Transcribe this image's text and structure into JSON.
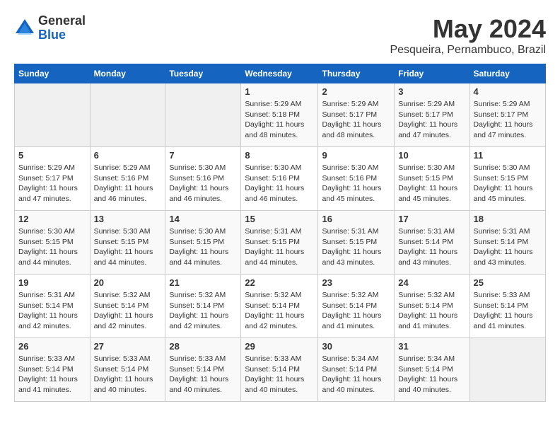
{
  "logo": {
    "general": "General",
    "blue": "Blue"
  },
  "title": "May 2024",
  "location": "Pesqueira, Pernambuco, Brazil",
  "days_of_week": [
    "Sunday",
    "Monday",
    "Tuesday",
    "Wednesday",
    "Thursday",
    "Friday",
    "Saturday"
  ],
  "weeks": [
    [
      {
        "day": "",
        "info": ""
      },
      {
        "day": "",
        "info": ""
      },
      {
        "day": "",
        "info": ""
      },
      {
        "day": "1",
        "sunrise": "Sunrise: 5:29 AM",
        "sunset": "Sunset: 5:18 PM",
        "daylight": "Daylight: 11 hours and 48 minutes."
      },
      {
        "day": "2",
        "sunrise": "Sunrise: 5:29 AM",
        "sunset": "Sunset: 5:17 PM",
        "daylight": "Daylight: 11 hours and 48 minutes."
      },
      {
        "day": "3",
        "sunrise": "Sunrise: 5:29 AM",
        "sunset": "Sunset: 5:17 PM",
        "daylight": "Daylight: 11 hours and 47 minutes."
      },
      {
        "day": "4",
        "sunrise": "Sunrise: 5:29 AM",
        "sunset": "Sunset: 5:17 PM",
        "daylight": "Daylight: 11 hours and 47 minutes."
      }
    ],
    [
      {
        "day": "5",
        "sunrise": "Sunrise: 5:29 AM",
        "sunset": "Sunset: 5:17 PM",
        "daylight": "Daylight: 11 hours and 47 minutes."
      },
      {
        "day": "6",
        "sunrise": "Sunrise: 5:29 AM",
        "sunset": "Sunset: 5:16 PM",
        "daylight": "Daylight: 11 hours and 46 minutes."
      },
      {
        "day": "7",
        "sunrise": "Sunrise: 5:30 AM",
        "sunset": "Sunset: 5:16 PM",
        "daylight": "Daylight: 11 hours and 46 minutes."
      },
      {
        "day": "8",
        "sunrise": "Sunrise: 5:30 AM",
        "sunset": "Sunset: 5:16 PM",
        "daylight": "Daylight: 11 hours and 46 minutes."
      },
      {
        "day": "9",
        "sunrise": "Sunrise: 5:30 AM",
        "sunset": "Sunset: 5:16 PM",
        "daylight": "Daylight: 11 hours and 45 minutes."
      },
      {
        "day": "10",
        "sunrise": "Sunrise: 5:30 AM",
        "sunset": "Sunset: 5:15 PM",
        "daylight": "Daylight: 11 hours and 45 minutes."
      },
      {
        "day": "11",
        "sunrise": "Sunrise: 5:30 AM",
        "sunset": "Sunset: 5:15 PM",
        "daylight": "Daylight: 11 hours and 45 minutes."
      }
    ],
    [
      {
        "day": "12",
        "sunrise": "Sunrise: 5:30 AM",
        "sunset": "Sunset: 5:15 PM",
        "daylight": "Daylight: 11 hours and 44 minutes."
      },
      {
        "day": "13",
        "sunrise": "Sunrise: 5:30 AM",
        "sunset": "Sunset: 5:15 PM",
        "daylight": "Daylight: 11 hours and 44 minutes."
      },
      {
        "day": "14",
        "sunrise": "Sunrise: 5:30 AM",
        "sunset": "Sunset: 5:15 PM",
        "daylight": "Daylight: 11 hours and 44 minutes."
      },
      {
        "day": "15",
        "sunrise": "Sunrise: 5:31 AM",
        "sunset": "Sunset: 5:15 PM",
        "daylight": "Daylight: 11 hours and 44 minutes."
      },
      {
        "day": "16",
        "sunrise": "Sunrise: 5:31 AM",
        "sunset": "Sunset: 5:15 PM",
        "daylight": "Daylight: 11 hours and 43 minutes."
      },
      {
        "day": "17",
        "sunrise": "Sunrise: 5:31 AM",
        "sunset": "Sunset: 5:14 PM",
        "daylight": "Daylight: 11 hours and 43 minutes."
      },
      {
        "day": "18",
        "sunrise": "Sunrise: 5:31 AM",
        "sunset": "Sunset: 5:14 PM",
        "daylight": "Daylight: 11 hours and 43 minutes."
      }
    ],
    [
      {
        "day": "19",
        "sunrise": "Sunrise: 5:31 AM",
        "sunset": "Sunset: 5:14 PM",
        "daylight": "Daylight: 11 hours and 42 minutes."
      },
      {
        "day": "20",
        "sunrise": "Sunrise: 5:32 AM",
        "sunset": "Sunset: 5:14 PM",
        "daylight": "Daylight: 11 hours and 42 minutes."
      },
      {
        "day": "21",
        "sunrise": "Sunrise: 5:32 AM",
        "sunset": "Sunset: 5:14 PM",
        "daylight": "Daylight: 11 hours and 42 minutes."
      },
      {
        "day": "22",
        "sunrise": "Sunrise: 5:32 AM",
        "sunset": "Sunset: 5:14 PM",
        "daylight": "Daylight: 11 hours and 42 minutes."
      },
      {
        "day": "23",
        "sunrise": "Sunrise: 5:32 AM",
        "sunset": "Sunset: 5:14 PM",
        "daylight": "Daylight: 11 hours and 41 minutes."
      },
      {
        "day": "24",
        "sunrise": "Sunrise: 5:32 AM",
        "sunset": "Sunset: 5:14 PM",
        "daylight": "Daylight: 11 hours and 41 minutes."
      },
      {
        "day": "25",
        "sunrise": "Sunrise: 5:33 AM",
        "sunset": "Sunset: 5:14 PM",
        "daylight": "Daylight: 11 hours and 41 minutes."
      }
    ],
    [
      {
        "day": "26",
        "sunrise": "Sunrise: 5:33 AM",
        "sunset": "Sunset: 5:14 PM",
        "daylight": "Daylight: 11 hours and 41 minutes."
      },
      {
        "day": "27",
        "sunrise": "Sunrise: 5:33 AM",
        "sunset": "Sunset: 5:14 PM",
        "daylight": "Daylight: 11 hours and 40 minutes."
      },
      {
        "day": "28",
        "sunrise": "Sunrise: 5:33 AM",
        "sunset": "Sunset: 5:14 PM",
        "daylight": "Daylight: 11 hours and 40 minutes."
      },
      {
        "day": "29",
        "sunrise": "Sunrise: 5:33 AM",
        "sunset": "Sunset: 5:14 PM",
        "daylight": "Daylight: 11 hours and 40 minutes."
      },
      {
        "day": "30",
        "sunrise": "Sunrise: 5:34 AM",
        "sunset": "Sunset: 5:14 PM",
        "daylight": "Daylight: 11 hours and 40 minutes."
      },
      {
        "day": "31",
        "sunrise": "Sunrise: 5:34 AM",
        "sunset": "Sunset: 5:14 PM",
        "daylight": "Daylight: 11 hours and 40 minutes."
      },
      {
        "day": "",
        "info": ""
      }
    ]
  ]
}
